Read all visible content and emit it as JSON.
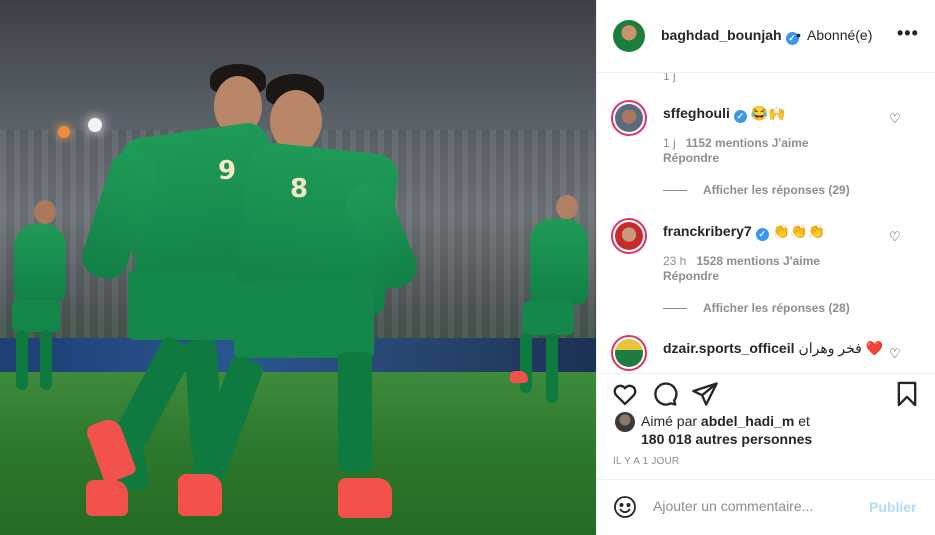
{
  "post": {
    "image_alt_icon": "photo-two-footballers-celebrating",
    "player_numbers": [
      "9",
      "8"
    ]
  },
  "header": {
    "username": "baghdad_bounjah",
    "verified_icon": "verified-badge-icon",
    "separator": "•",
    "follow_status": "Abonné(e)",
    "more_icon": "more-options-icon"
  },
  "comments": {
    "cut_time": "1 j",
    "items": [
      {
        "username": "sffeghouli",
        "text": "😂🙌",
        "time": "1 j",
        "likes": "1152 mentions J'aime",
        "reply": "Répondre",
        "view_replies": "Afficher les réponses (29)"
      },
      {
        "username": "franckribery7",
        "text": "👏👏👏",
        "time": "23 h",
        "likes": "1528 mentions J'aime",
        "reply": "Répondre",
        "view_replies": "Afficher les réponses (28)"
      },
      {
        "username": "dzair.sports_officeil",
        "text": "فخر وهران ❤️"
      }
    ]
  },
  "actions": {
    "like_icon": "heart-icon",
    "comment_icon": "comment-icon",
    "share_icon": "share-icon",
    "save_icon": "bookmark-icon"
  },
  "likes": {
    "prefix": "Aimé par",
    "user": "abdel_hadi_m",
    "conj": "et",
    "others": "180 018 autres personnes"
  },
  "date": "IL Y A 1 JOUR",
  "add_comment": {
    "placeholder": "Ajouter un commentaire...",
    "post_label": "Publier"
  },
  "colors": {
    "verified": "#3897f0",
    "muted_text": "#8e8e8e",
    "post_button_disabled": "#b3dbff",
    "jersey_green": "#1f9b58",
    "story_ring": "#e1306c"
  }
}
